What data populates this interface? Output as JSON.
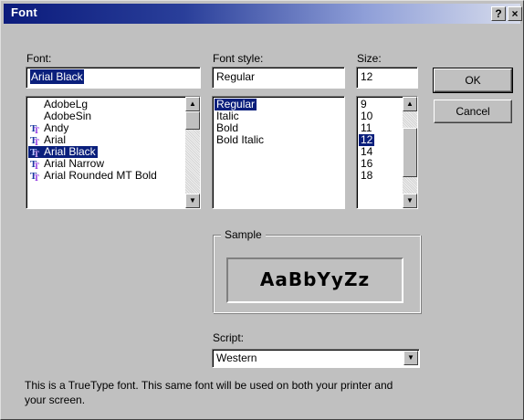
{
  "window": {
    "title": "Font",
    "help_label": "?",
    "close_label": "×"
  },
  "font": {
    "label": "Font:",
    "value": "Arial Black",
    "items": [
      {
        "label": "AdobeLg",
        "icon": "none-icon",
        "selected": false
      },
      {
        "label": "AdobeSin",
        "icon": "none-icon",
        "selected": false
      },
      {
        "label": "Andy",
        "icon": "truetype-icon",
        "selected": false
      },
      {
        "label": "Arial",
        "icon": "truetype-icon",
        "selected": false
      },
      {
        "label": "Arial Black",
        "icon": "truetype-icon",
        "selected": true
      },
      {
        "label": "Arial Narrow",
        "icon": "truetype-icon",
        "selected": false
      },
      {
        "label": "Arial Rounded MT Bold",
        "icon": "truetype-icon",
        "selected": false
      }
    ]
  },
  "style": {
    "label": "Font style:",
    "value": "Regular",
    "items": [
      {
        "label": "Regular",
        "selected": true
      },
      {
        "label": "Italic",
        "selected": false
      },
      {
        "label": "Bold",
        "selected": false
      },
      {
        "label": "Bold Italic",
        "selected": false
      }
    ]
  },
  "size": {
    "label": "Size:",
    "value": "12",
    "items": [
      {
        "label": "9",
        "selected": false
      },
      {
        "label": "10",
        "selected": false
      },
      {
        "label": "11",
        "selected": false
      },
      {
        "label": "12",
        "selected": true
      },
      {
        "label": "14",
        "selected": false
      },
      {
        "label": "16",
        "selected": false
      },
      {
        "label": "18",
        "selected": false
      }
    ]
  },
  "buttons": {
    "ok_label": "OK",
    "cancel_label": "Cancel"
  },
  "sample": {
    "label": "Sample",
    "text": "AaBbYyZz"
  },
  "script": {
    "label": "Script:",
    "value": "Western"
  },
  "info": "This is a TrueType font. This same font will be used on both your printer and your screen.",
  "colors": {
    "face": "#c0c0c0",
    "selection": "#0a1f7c",
    "title_start": "#0b1b7c"
  }
}
